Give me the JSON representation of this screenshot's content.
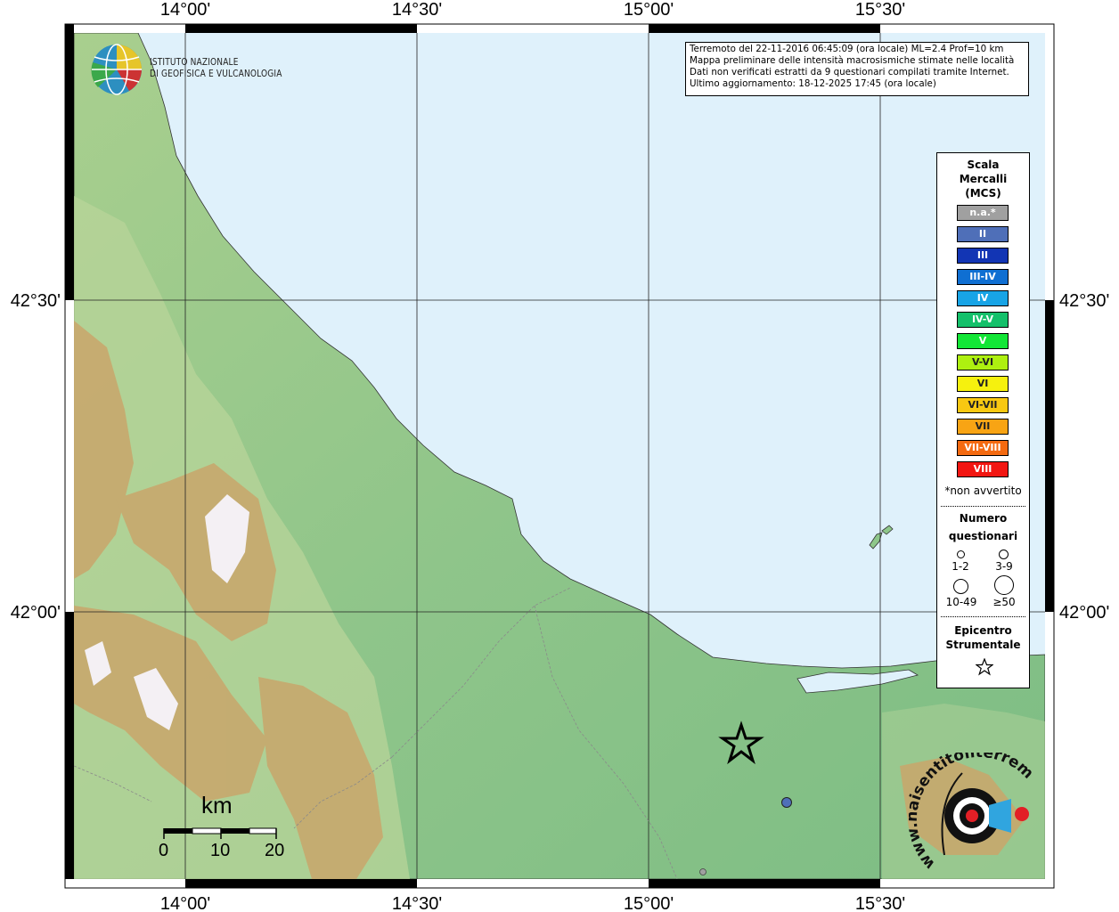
{
  "map": {
    "lon_labels": [
      "14°00'",
      "14°30'",
      "15°00'",
      "15°30'"
    ],
    "lat_labels": [
      "42°30'",
      "42°00'"
    ],
    "colors": {
      "sea": "#dff1fb",
      "lowland": "#8ec78a",
      "hills": "#c2d8a0",
      "mountains": "#c9a66b",
      "peaks": "#f4f0f4"
    }
  },
  "institute": {
    "line1": "ISTITUTO NAZIONALE",
    "line2": "DI GEOFISICA E VULCANOLOGIA"
  },
  "info": {
    "line1": "Terremoto del 22-11-2016 06:45:09 (ora locale) ML=2.4 Prof=10 km",
    "line2": "Mappa preliminare delle intensità macrosismiche stimate nelle località",
    "line3": "Dati non verificati estratti da 9 questionari compilati tramite Internet.",
    "line4": "Ultimo aggiornamento: 18-12-2025 17:45 (ora locale)"
  },
  "legend": {
    "title": "Scala Mercalli (MCS)",
    "scale": [
      {
        "label": "n.a.*",
        "color": "#a0a0a0"
      },
      {
        "label": "II",
        "color": "#4f6fb8"
      },
      {
        "label": "III",
        "color": "#1235b4"
      },
      {
        "label": "III-IV",
        "color": "#0f6fd2"
      },
      {
        "label": "IV",
        "color": "#18a4e6"
      },
      {
        "label": "IV-V",
        "color": "#14c06a"
      },
      {
        "label": "V",
        "color": "#12e636"
      },
      {
        "label": "V-VI",
        "color": "#aef010"
      },
      {
        "label": "VI",
        "color": "#f6f10e"
      },
      {
        "label": "VI-VII",
        "color": "#f8c812"
      },
      {
        "label": "VII",
        "color": "#f8a414"
      },
      {
        "label": "VII-VIII",
        "color": "#f46a10"
      },
      {
        "label": "VIII",
        "color": "#f21612"
      }
    ],
    "footnote": "*non avvertito",
    "count_title_1": "Numero",
    "count_title_2": "questionari",
    "sizes": [
      "1-2",
      "3-9",
      "10-49",
      "≥50"
    ],
    "epicenter_1": "Epicentro",
    "epicenter_2": "Strumentale"
  },
  "scalebar": {
    "unit": "km",
    "ticks": [
      "0",
      "10",
      "20"
    ]
  },
  "watermark": "www.haisentitoilterremoto.it",
  "observations": [
    {
      "intensity": "II",
      "color": "#4f6fb8"
    },
    {
      "intensity": "n.a.*",
      "color": "#a0a0a0"
    }
  ]
}
